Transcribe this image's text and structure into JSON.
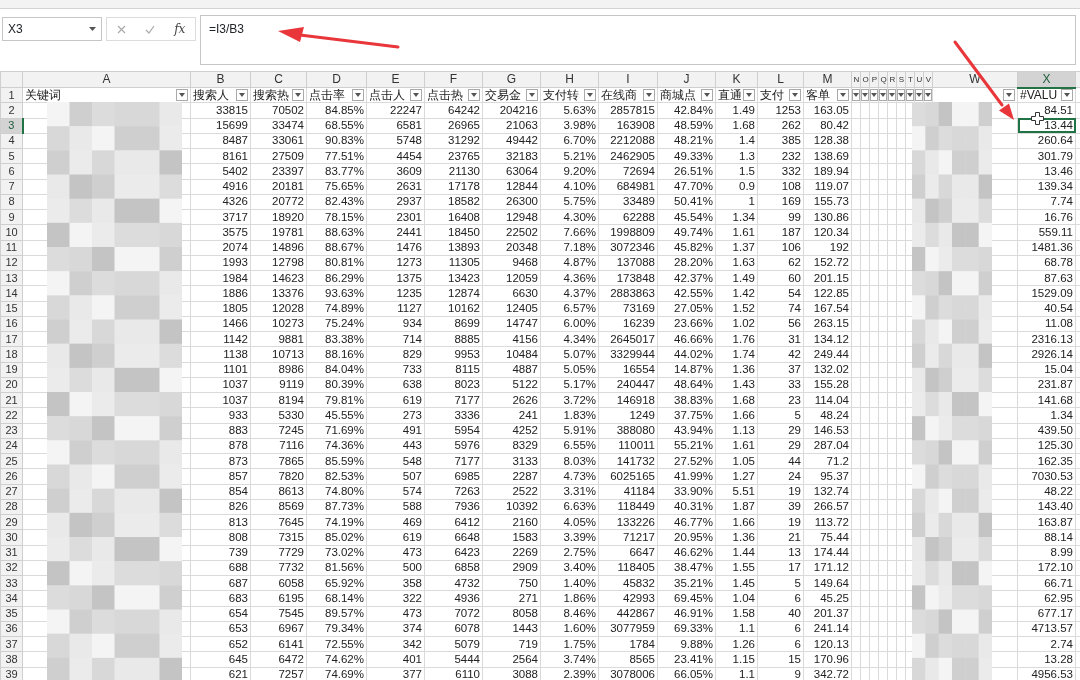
{
  "name_box": "X3",
  "function_label": "fx",
  "formula": "=I3/B3",
  "columns": [
    {
      "letter": "A",
      "kind": "key",
      "header": "关键词",
      "selected": false
    },
    {
      "letter": "B",
      "kind": "data",
      "header": "搜索人",
      "selected": false
    },
    {
      "letter": "C",
      "kind": "data",
      "header": "搜索热",
      "selected": false
    },
    {
      "letter": "D",
      "kind": "data",
      "header": "点击率",
      "selected": false
    },
    {
      "letter": "E",
      "kind": "data",
      "header": "点击人",
      "selected": false
    },
    {
      "letter": "F",
      "kind": "data",
      "header": "点击热",
      "selected": false
    },
    {
      "letter": "G",
      "kind": "data",
      "header": "交易金",
      "selected": false
    },
    {
      "letter": "H",
      "kind": "data",
      "header": "支付转",
      "selected": false
    },
    {
      "letter": "I",
      "kind": "data",
      "header": "在线商",
      "selected": false
    },
    {
      "letter": "J",
      "kind": "data",
      "header": "商城点",
      "selected": false
    },
    {
      "letter": "K",
      "kind": "data",
      "header": "直通",
      "selected": false
    },
    {
      "letter": "L",
      "kind": "data",
      "header": "支付",
      "selected": false
    },
    {
      "letter": "M",
      "kind": "data",
      "header": "客单",
      "selected": false
    },
    {
      "letter": "N",
      "kind": "narrow",
      "selected": false
    },
    {
      "letter": "O",
      "kind": "narrow",
      "selected": false
    },
    {
      "letter": "P",
      "kind": "narrow",
      "selected": false
    },
    {
      "letter": "Q",
      "kind": "narrow",
      "selected": false
    },
    {
      "letter": "R",
      "kind": "narrow",
      "selected": false
    },
    {
      "letter": "S",
      "kind": "narrow",
      "selected": false
    },
    {
      "letter": "T",
      "kind": "narrow",
      "selected": false
    },
    {
      "letter": "U",
      "kind": "narrow",
      "selected": false
    },
    {
      "letter": "V",
      "kind": "narrow",
      "selected": false
    },
    {
      "letter": "W",
      "kind": "blurred",
      "selected": false
    },
    {
      "letter": "X",
      "kind": "data",
      "header": "#VALU",
      "selected": true
    }
  ],
  "header_row_number": "1",
  "rows": [
    {
      "number": "2",
      "selected": false,
      "values": [
        "33815",
        "70502",
        "84.85%",
        "22247",
        "64242",
        "204216",
        "5.63%",
        "2857815",
        "42.84%",
        "1.49",
        "1253",
        "163.05",
        "84.51"
      ]
    },
    {
      "number": "3",
      "selected": true,
      "values": [
        "15699",
        "33474",
        "68.55%",
        "6581",
        "26965",
        "21063",
        "3.98%",
        "163908",
        "48.59%",
        "1.68",
        "262",
        "80.42",
        "13.44"
      ]
    },
    {
      "number": "4",
      "selected": false,
      "values": [
        "8487",
        "33061",
        "90.83%",
        "5748",
        "31292",
        "49442",
        "6.70%",
        "2212088",
        "48.21%",
        "1.4",
        "385",
        "128.38",
        "260.64"
      ]
    },
    {
      "number": "5",
      "selected": false,
      "values": [
        "8161",
        "27509",
        "77.51%",
        "4454",
        "23765",
        "32183",
        "5.21%",
        "2462905",
        "49.33%",
        "1.3",
        "232",
        "138.69",
        "301.79"
      ]
    },
    {
      "number": "6",
      "selected": false,
      "values": [
        "5402",
        "23397",
        "83.77%",
        "3609",
        "21130",
        "63064",
        "9.20%",
        "72694",
        "26.51%",
        "1.5",
        "332",
        "189.94",
        "13.46"
      ]
    },
    {
      "number": "7",
      "selected": false,
      "values": [
        "4916",
        "20181",
        "75.65%",
        "2631",
        "17178",
        "12844",
        "4.10%",
        "684981",
        "47.70%",
        "0.9",
        "108",
        "119.07",
        "139.34"
      ]
    },
    {
      "number": "8",
      "selected": false,
      "values": [
        "4326",
        "20772",
        "82.43%",
        "2937",
        "18582",
        "26300",
        "5.75%",
        "33489",
        "50.41%",
        "1",
        "169",
        "155.73",
        "7.74"
      ]
    },
    {
      "number": "9",
      "selected": false,
      "values": [
        "3717",
        "18920",
        "78.15%",
        "2301",
        "16408",
        "12948",
        "4.30%",
        "62288",
        "45.54%",
        "1.34",
        "99",
        "130.86",
        "16.76"
      ]
    },
    {
      "number": "10",
      "selected": false,
      "values": [
        "3575",
        "19781",
        "88.63%",
        "2441",
        "18450",
        "22502",
        "7.66%",
        "1998809",
        "49.74%",
        "1.61",
        "187",
        "120.34",
        "559.11"
      ]
    },
    {
      "number": "11",
      "selected": false,
      "values": [
        "2074",
        "14896",
        "88.67%",
        "1476",
        "13893",
        "20348",
        "7.18%",
        "3072346",
        "45.82%",
        "1.37",
        "106",
        "192",
        "1481.36"
      ]
    },
    {
      "number": "12",
      "selected": false,
      "values": [
        "1993",
        "12798",
        "80.81%",
        "1273",
        "11305",
        "9468",
        "4.87%",
        "137088",
        "28.20%",
        "1.63",
        "62",
        "152.72",
        "68.78"
      ]
    },
    {
      "number": "13",
      "selected": false,
      "values": [
        "1984",
        "14623",
        "86.29%",
        "1375",
        "13423",
        "12059",
        "4.36%",
        "173848",
        "42.37%",
        "1.49",
        "60",
        "201.15",
        "87.63"
      ]
    },
    {
      "number": "14",
      "selected": false,
      "values": [
        "1886",
        "13376",
        "93.63%",
        "1235",
        "12874",
        "6630",
        "4.37%",
        "2883863",
        "42.55%",
        "1.42",
        "54",
        "122.85",
        "1529.09"
      ]
    },
    {
      "number": "15",
      "selected": false,
      "values": [
        "1805",
        "12028",
        "74.89%",
        "1127",
        "10162",
        "12405",
        "6.57%",
        "73169",
        "27.05%",
        "1.52",
        "74",
        "167.54",
        "40.54"
      ]
    },
    {
      "number": "16",
      "selected": false,
      "values": [
        "1466",
        "10273",
        "75.24%",
        "934",
        "8699",
        "14747",
        "6.00%",
        "16239",
        "23.66%",
        "1.02",
        "56",
        "263.15",
        "11.08"
      ]
    },
    {
      "number": "17",
      "selected": false,
      "values": [
        "1142",
        "9881",
        "83.38%",
        "714",
        "8885",
        "4156",
        "4.34%",
        "2645017",
        "46.66%",
        "1.76",
        "31",
        "134.12",
        "2316.13"
      ]
    },
    {
      "number": "18",
      "selected": false,
      "values": [
        "1138",
        "10713",
        "88.16%",
        "829",
        "9953",
        "10484",
        "5.07%",
        "3329944",
        "44.02%",
        "1.74",
        "42",
        "249.44",
        "2926.14"
      ]
    },
    {
      "number": "19",
      "selected": false,
      "values": [
        "1101",
        "8986",
        "84.04%",
        "733",
        "8115",
        "4887",
        "5.05%",
        "16554",
        "14.87%",
        "1.36",
        "37",
        "132.02",
        "15.04"
      ]
    },
    {
      "number": "20",
      "selected": false,
      "values": [
        "1037",
        "9119",
        "80.39%",
        "638",
        "8023",
        "5122",
        "5.17%",
        "240447",
        "48.64%",
        "1.43",
        "33",
        "155.28",
        "231.87"
      ]
    },
    {
      "number": "21",
      "selected": false,
      "values": [
        "1037",
        "8194",
        "79.81%",
        "619",
        "7177",
        "2626",
        "3.72%",
        "146918",
        "38.83%",
        "1.68",
        "23",
        "114.04",
        "141.68"
      ]
    },
    {
      "number": "22",
      "selected": false,
      "values": [
        "933",
        "5330",
        "45.55%",
        "273",
        "3336",
        "241",
        "1.83%",
        "1249",
        "37.75%",
        "1.66",
        "5",
        "48.24",
        "1.34"
      ]
    },
    {
      "number": "23",
      "selected": false,
      "values": [
        "883",
        "7245",
        "71.69%",
        "491",
        "5954",
        "4252",
        "5.91%",
        "388080",
        "43.94%",
        "1.13",
        "29",
        "146.53",
        "439.50"
      ]
    },
    {
      "number": "24",
      "selected": false,
      "values": [
        "878",
        "7116",
        "74.36%",
        "443",
        "5976",
        "8329",
        "6.55%",
        "110011",
        "55.21%",
        "1.61",
        "29",
        "287.04",
        "125.30"
      ]
    },
    {
      "number": "25",
      "selected": false,
      "values": [
        "873",
        "7865",
        "85.59%",
        "548",
        "7177",
        "3133",
        "8.03%",
        "141732",
        "27.52%",
        "1.05",
        "44",
        "71.2",
        "162.35"
      ]
    },
    {
      "number": "26",
      "selected": false,
      "values": [
        "857",
        "7820",
        "82.53%",
        "507",
        "6985",
        "2287",
        "4.73%",
        "6025165",
        "41.99%",
        "1.27",
        "24",
        "95.37",
        "7030.53"
      ]
    },
    {
      "number": "27",
      "selected": false,
      "values": [
        "854",
        "8613",
        "74.80%",
        "574",
        "7263",
        "2522",
        "3.31%",
        "41184",
        "33.90%",
        "5.51",
        "19",
        "132.74",
        "48.22"
      ]
    },
    {
      "number": "28",
      "selected": false,
      "values": [
        "826",
        "8569",
        "87.73%",
        "588",
        "7936",
        "10392",
        "6.63%",
        "118449",
        "40.31%",
        "1.87",
        "39",
        "266.57",
        "143.40"
      ]
    },
    {
      "number": "29",
      "selected": false,
      "values": [
        "813",
        "7645",
        "74.19%",
        "469",
        "6412",
        "2160",
        "4.05%",
        "133226",
        "46.77%",
        "1.66",
        "19",
        "113.72",
        "163.87"
      ]
    },
    {
      "number": "30",
      "selected": false,
      "values": [
        "808",
        "7315",
        "85.02%",
        "619",
        "6648",
        "1583",
        "3.39%",
        "71217",
        "20.95%",
        "1.36",
        "21",
        "75.44",
        "88.14"
      ]
    },
    {
      "number": "31",
      "selected": false,
      "values": [
        "739",
        "7729",
        "73.02%",
        "473",
        "6423",
        "2269",
        "2.75%",
        "6647",
        "46.62%",
        "1.44",
        "13",
        "174.44",
        "8.99"
      ]
    },
    {
      "number": "32",
      "selected": false,
      "values": [
        "688",
        "7732",
        "81.56%",
        "500",
        "6858",
        "2909",
        "3.40%",
        "118405",
        "38.47%",
        "1.55",
        "17",
        "171.12",
        "172.10"
      ]
    },
    {
      "number": "33",
      "selected": false,
      "values": [
        "687",
        "6058",
        "65.92%",
        "358",
        "4732",
        "750",
        "1.40%",
        "45832",
        "35.21%",
        "1.45",
        "5",
        "149.64",
        "66.71"
      ]
    },
    {
      "number": "34",
      "selected": false,
      "values": [
        "683",
        "6195",
        "68.14%",
        "322",
        "4936",
        "271",
        "1.86%",
        "42993",
        "69.45%",
        "1.04",
        "6",
        "45.25",
        "62.95"
      ]
    },
    {
      "number": "35",
      "selected": false,
      "values": [
        "654",
        "7545",
        "89.57%",
        "473",
        "7072",
        "8058",
        "8.46%",
        "442867",
        "46.91%",
        "1.58",
        "40",
        "201.37",
        "677.17"
      ]
    },
    {
      "number": "36",
      "selected": false,
      "values": [
        "653",
        "6967",
        "79.34%",
        "374",
        "6078",
        "1443",
        "1.60%",
        "3077959",
        "69.33%",
        "1.1",
        "6",
        "241.14",
        "4713.57"
      ]
    },
    {
      "number": "37",
      "selected": false,
      "values": [
        "652",
        "6141",
        "72.55%",
        "342",
        "5079",
        "719",
        "1.75%",
        "1784",
        "9.88%",
        "1.26",
        "6",
        "120.13",
        "2.74"
      ]
    },
    {
      "number": "38",
      "selected": false,
      "values": [
        "645",
        "6472",
        "74.62%",
        "401",
        "5444",
        "2564",
        "3.74%",
        "8565",
        "23.41%",
        "1.15",
        "15",
        "170.96",
        "13.28"
      ]
    },
    {
      "number": "39",
      "selected": false,
      "values": [
        "621",
        "7257",
        "74.69%",
        "377",
        "6110",
        "3088",
        "2.39%",
        "3078006",
        "66.05%",
        "1.1",
        "9",
        "342.72",
        "4956.53"
      ]
    }
  ]
}
